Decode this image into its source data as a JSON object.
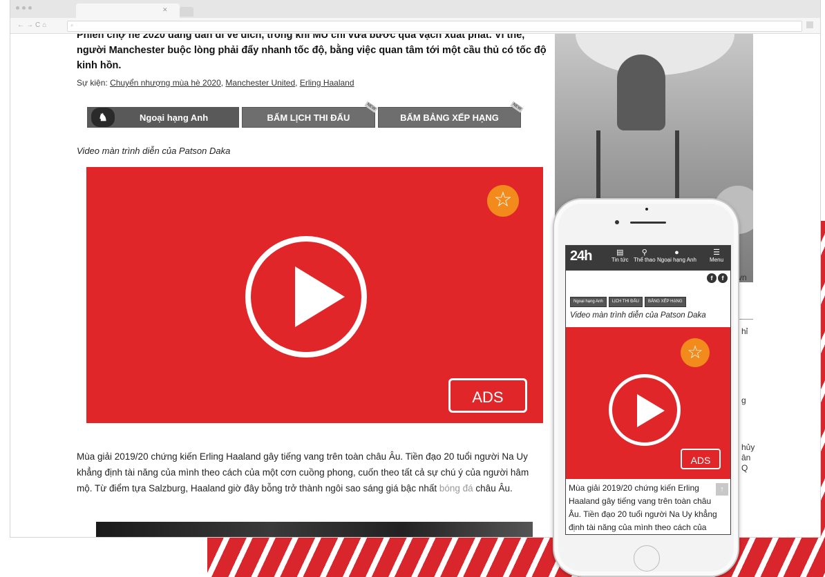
{
  "article": {
    "lead": "Phiên chợ hè 2020 đang dần đi về đích, trong khi MU chỉ vừa bước qua vạch xuất phát. Vì thế, người Manchester buộc lòng phải đẩy nhanh tốc độ, bằng việc quan tâm tới một cầu thủ có tốc độ kinh hồn.",
    "events_label": "Sự kiện:",
    "events": [
      "Chuyển nhượng mùa hè 2020",
      "Manchester United",
      "Erling Haaland"
    ],
    "nav": {
      "premier_league": "Ngoại hạng Anh",
      "schedule": "BẤM LỊCH THI ĐẤU",
      "ranking": "BẤM BẢNG XẾP HẠNG",
      "new_tag": "NEW"
    },
    "video_caption": "Video màn trình diễn của Patson Daka",
    "ads_label": "ADS",
    "body_part1": "Mùa giải 2019/20 chứng kiến Erling Haaland gây tiếng vang trên toàn châu Âu. Tiền đạo 20 tuổi người Na Uy khẳng định tài năng của mình theo cách của một cơn cuồng phong, cuốn theo tất cả sự chú ý của người hâm mộ. Từ điểm tựa Salzburg, Haaland giờ đây bỗng trở thành ngôi sao sáng giá bậc nhất ",
    "body_link": "bóng đá",
    "body_part2": " châu Âu."
  },
  "sidebar": {
    "fragments": [
      "vn",
      "hỉ",
      "g",
      "hủy",
      "ân",
      "Q"
    ]
  },
  "phone": {
    "logo": "24h",
    "nav": [
      "Tin tức",
      "Thể thao",
      "Ngoại hạng Anh",
      "Menu"
    ],
    "social": [
      "f",
      "f"
    ],
    "buttons": [
      "Ngoại hạng Anh",
      "LỊCH THI ĐẤU",
      "BẢNG XẾP HẠNG"
    ],
    "caption": "Video màn trình diễn của Patson Daka",
    "ads_label": "ADS",
    "text": "Mùa giải 2019/20 chứng kiến Erling Haaland gây tiếng vang trên toàn châu Âu. Tiền đạo 20 tuổi người Na Uy khẳng định tài năng của mình theo cách của"
  },
  "colors": {
    "accent_red": "#e02629",
    "star_orange": "#f28a1c"
  },
  "icons": [
    "play-icon",
    "star-icon",
    "premier-league-lion-icon",
    "hamburger-menu-icon",
    "scroll-up-icon"
  ]
}
